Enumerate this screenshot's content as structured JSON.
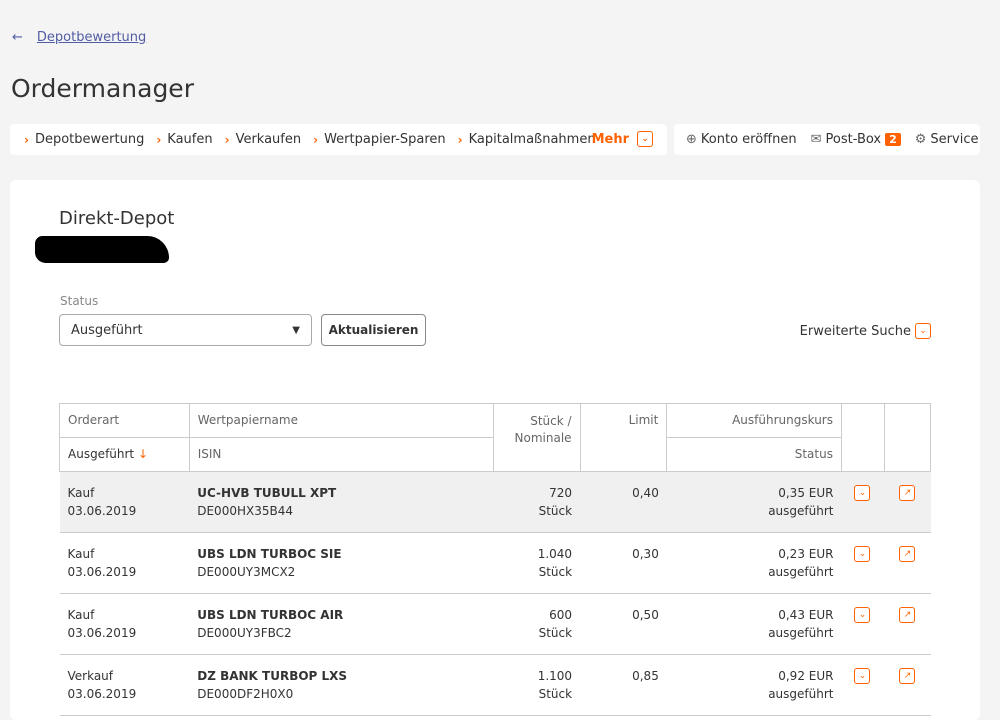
{
  "back": {
    "label": "Depotbewertung"
  },
  "page_title": "Ordermanager",
  "nav": {
    "items": [
      "Depotbewertung",
      "Kaufen",
      "Verkaufen",
      "Wertpapier-Sparen",
      "Kapitalmaßnahmen"
    ],
    "more": "Mehr"
  },
  "nav2": {
    "konto": "Konto eröffnen",
    "postbox": "Post-Box",
    "postbox_count": "2",
    "service": "Service"
  },
  "depot": {
    "name": "Direkt-Depot"
  },
  "filter": {
    "status_label": "Status",
    "status_value": "Ausgeführt",
    "refresh": "Aktualisieren",
    "advanced": "Erweiterte Suche"
  },
  "table": {
    "headers": {
      "orderart": "Orderart",
      "ausgefuehrt": "Ausgeführt",
      "wertpapier": "Wertpapiername",
      "isin": "ISIN",
      "stueck": "Stück / Nominale",
      "limit": "Limit",
      "kurs": "Ausführungskurs",
      "status": "Status"
    },
    "rows": [
      {
        "art": "Kauf",
        "date": "03.06.2019",
        "name": "UC-HVB TUBULL XPT",
        "isin": "DE000HX35B44",
        "qty": "720",
        "unit": "Stück",
        "limit": "0,40",
        "price": "0,35 EUR",
        "status": "ausgeführt"
      },
      {
        "art": "Kauf",
        "date": "03.06.2019",
        "name": "UBS LDN TURBOC SIE",
        "isin": "DE000UY3MCX2",
        "qty": "1.040",
        "unit": "Stück",
        "limit": "0,30",
        "price": "0,23 EUR",
        "status": "ausgeführt"
      },
      {
        "art": "Kauf",
        "date": "03.06.2019",
        "name": "UBS LDN TURBOC AIR",
        "isin": "DE000UY3FBC2",
        "qty": "600",
        "unit": "Stück",
        "limit": "0,50",
        "price": "0,43 EUR",
        "status": "ausgeführt"
      },
      {
        "art": "Verkauf",
        "date": "03.06.2019",
        "name": "DZ BANK TURBOP LXS",
        "isin": "DE000DF2H0X0",
        "qty": "1.100",
        "unit": "Stück",
        "limit": "0,85",
        "price": "0,92 EUR",
        "status": "ausgeführt"
      }
    ]
  }
}
